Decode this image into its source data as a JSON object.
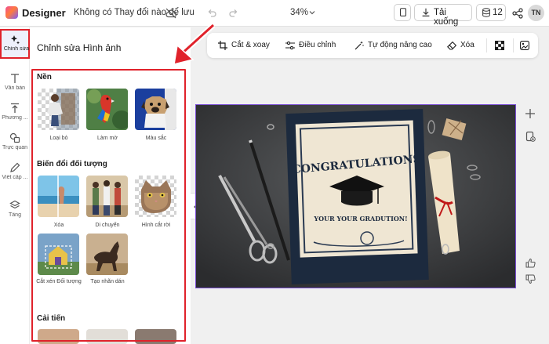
{
  "header": {
    "app_name": "Designer",
    "doc_status": "Không có Thay đổi nào để lưu",
    "zoom": "34%",
    "download_label": "Tải xuống",
    "credits": "12",
    "avatar_initials": "TN"
  },
  "rail": {
    "items": [
      {
        "label": "Chỉnh sửa",
        "icon": "sparkle-edit-icon",
        "active": true
      },
      {
        "label": "Văn bản",
        "icon": "text-icon"
      },
      {
        "label": "Phương ...",
        "icon": "upload-icon"
      },
      {
        "label": "Trực quan",
        "icon": "shapes-icon"
      },
      {
        "label": "Viết cấp ...",
        "icon": "pen-icon"
      },
      {
        "label": "Tầng",
        "icon": "layers-icon"
      }
    ]
  },
  "panel": {
    "title": "Chỉnh sửa Hình ảnh",
    "sections": [
      {
        "title": "Nền",
        "items": [
          "Loại bỏ",
          "Làm mờ",
          "Màu sắc"
        ]
      },
      {
        "title": "Biến đổi đối tượng",
        "items": [
          "Xóa",
          "Di chuyển",
          "Hình cắt rời",
          "Cắt xén Đối tượng",
          "Tạo nhãn dán"
        ]
      },
      {
        "title": "Cải tiến",
        "items": []
      }
    ]
  },
  "toolbar": {
    "items": [
      {
        "label": "Cắt & xoay",
        "icon": "crop-icon"
      },
      {
        "label": "Điều chỉnh",
        "icon": "sliders-icon"
      },
      {
        "label": "Tự động nâng cao",
        "icon": "magic-wand-icon"
      },
      {
        "label": "Xóa",
        "icon": "eraser-icon"
      }
    ]
  },
  "canvas": {
    "certificate_title": "CONGRATULATIONS",
    "certificate_subtitle": "YOUR YOUR GRADUTION!"
  },
  "colors": {
    "accent": "#7b4fd6",
    "highlight_red": "#e0222b"
  }
}
